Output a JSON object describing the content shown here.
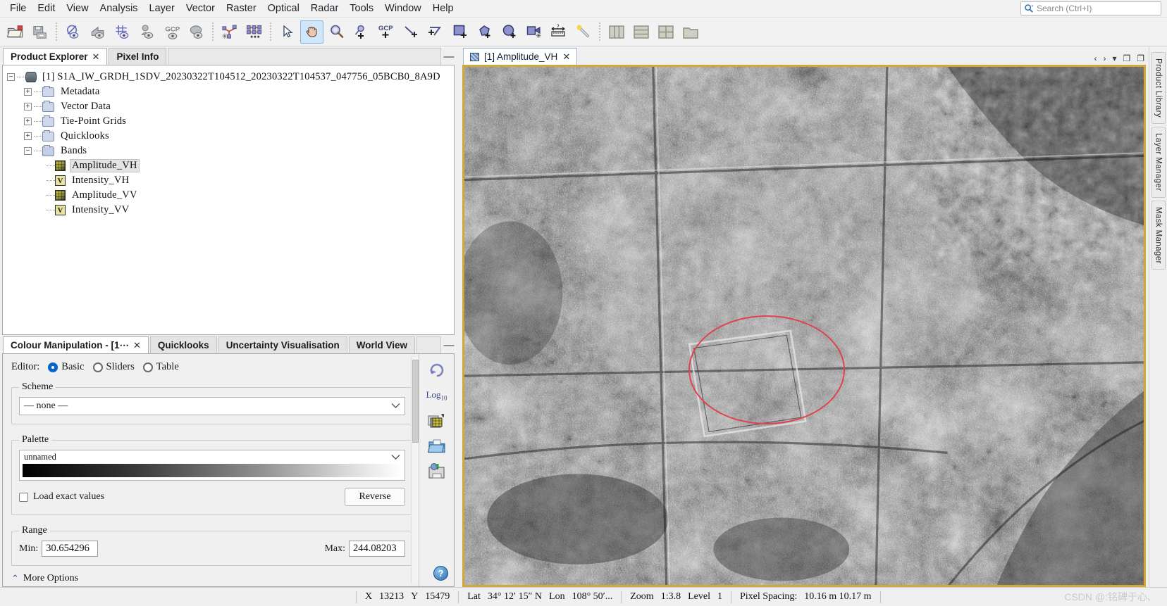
{
  "app": {
    "title": "SNAP Desktop"
  },
  "menubar": {
    "items": [
      {
        "label": "File"
      },
      {
        "label": "Edit"
      },
      {
        "label": "View"
      },
      {
        "label": "Analysis"
      },
      {
        "label": "Layer"
      },
      {
        "label": "Vector"
      },
      {
        "label": "Raster"
      },
      {
        "label": "Optical"
      },
      {
        "label": "Radar"
      },
      {
        "label": "Tools"
      },
      {
        "label": "Window"
      },
      {
        "label": "Help"
      }
    ],
    "search": {
      "icon": "search-icon",
      "placeholder": "Search  (Ctrl+I)"
    }
  },
  "toolbar": {
    "groups": [
      {
        "buttons": [
          {
            "name": "open-product-button",
            "icon": "open-folder-icon",
            "active": false
          },
          {
            "name": "save-product-button",
            "icon": "save-disk-icon",
            "active": false
          }
        ]
      },
      {
        "buttons": [
          {
            "name": "no-data-overlay-button",
            "icon": "no-data-overlay-icon",
            "active": false
          },
          {
            "name": "geo-coding-overlay-button",
            "icon": "geo-coding-overlay-icon",
            "active": false
          },
          {
            "name": "graticule-overlay-button",
            "icon": "graticule-overlay-icon",
            "active": false
          },
          {
            "name": "pin-overlay-button",
            "icon": "pin-overlay-icon",
            "active": false
          },
          {
            "name": "gcp-overlay-button",
            "icon": "gcp-overlay-icon",
            "active": false
          },
          {
            "name": "mask-overlay-button",
            "icon": "mask-overlay-icon",
            "active": false
          }
        ]
      },
      {
        "buttons": [
          {
            "name": "pin-manager-button",
            "icon": "pin-manager-icon",
            "active": false
          },
          {
            "name": "gcp-manager-button",
            "icon": "gcp-manager-icon",
            "active": false
          }
        ]
      },
      {
        "buttons": [
          {
            "name": "select-tool-button",
            "icon": "arrow-cursor-icon",
            "active": false
          },
          {
            "name": "pan-tool-button",
            "icon": "hand-pan-icon",
            "active": true
          },
          {
            "name": "zoom-tool-button",
            "icon": "magnifier-icon",
            "active": false
          },
          {
            "name": "pin-placing-tool-button",
            "icon": "pin-plus-icon",
            "active": false
          },
          {
            "name": "gcp-placing-tool-button",
            "icon": "gcp-plus-icon",
            "active": false
          },
          {
            "name": "line-drawing-tool-button",
            "icon": "line-plus-icon",
            "active": false
          },
          {
            "name": "polyline-drawing-tool-button",
            "icon": "polyline-plus-icon",
            "active": false
          },
          {
            "name": "rectangle-drawing-tool-button",
            "icon": "rectangle-plus-icon",
            "active": false
          },
          {
            "name": "polygon-drawing-tool-button",
            "icon": "polygon-plus-icon",
            "active": false
          },
          {
            "name": "ellipse-drawing-tool-button",
            "icon": "ellipse-plus-icon",
            "active": false
          },
          {
            "name": "magic-stick-button",
            "icon": "magic-stick-icon",
            "active": false
          },
          {
            "name": "range-finder-button",
            "icon": "measure-ruler-icon",
            "active": false
          },
          {
            "name": "colour-picker-button",
            "icon": "magic-wand-icon",
            "active": false
          }
        ]
      },
      {
        "buttons": [
          {
            "name": "tile-vertically-button",
            "icon": "tile-vertical-icon",
            "active": false
          },
          {
            "name": "tile-horizontally-button",
            "icon": "tile-horizontal-icon",
            "active": false
          },
          {
            "name": "tile-evenly-button",
            "icon": "tile-grid-icon",
            "active": false
          },
          {
            "name": "tile-single-button",
            "icon": "tile-single-icon",
            "active": false
          }
        ]
      }
    ]
  },
  "explorer": {
    "tabs": [
      {
        "label": "Product Explorer",
        "active": true,
        "closable": true
      },
      {
        "label": "Pixel Info",
        "active": false,
        "closable": false
      }
    ],
    "minimize_glyph": "—",
    "tree": {
      "root": {
        "label": "[1]  S1A_IW_GRDH_1SDV_20230322T104512_20230322T104537_047756_05BCB0_8A9D",
        "expander": "−",
        "icon": "product-icon"
      },
      "children": [
        {
          "label": "Metadata",
          "expander": "+",
          "icon": "folder-icon",
          "selected": false
        },
        {
          "label": "Vector Data",
          "expander": "+",
          "icon": "folder-icon",
          "selected": false
        },
        {
          "label": "Tie-Point Grids",
          "expander": "+",
          "icon": "folder-icon",
          "selected": false
        },
        {
          "label": "Quicklooks",
          "expander": "+",
          "icon": "folder-icon",
          "selected": false
        },
        {
          "label": "Bands",
          "expander": "−",
          "icon": "folder-open-icon",
          "selected": false
        }
      ],
      "bands": [
        {
          "label": "Amplitude_VH",
          "icon": "band-icon",
          "selected": true
        },
        {
          "label": "Intensity_VH",
          "icon": "virtual-band-icon",
          "selected": false
        },
        {
          "label": "Amplitude_VV",
          "icon": "band-icon",
          "selected": false
        },
        {
          "label": "Intensity_VV",
          "icon": "virtual-band-icon",
          "selected": false
        }
      ]
    }
  },
  "colour_manipulation": {
    "tabs": [
      {
        "label": "Colour Manipulation - [1⋯",
        "active": true,
        "closable": true
      },
      {
        "label": "Quicklooks",
        "active": false,
        "closable": false
      },
      {
        "label": "Uncertainty Visualisation",
        "active": false,
        "closable": false
      },
      {
        "label": "World View",
        "active": false,
        "closable": false
      }
    ],
    "minimize_glyph": "—",
    "editor": {
      "label": "Editor:",
      "options": [
        {
          "label": "Basic",
          "selected": true
        },
        {
          "label": "Sliders",
          "selected": false
        },
        {
          "label": "Table",
          "selected": false
        }
      ]
    },
    "scheme": {
      "legend": "Scheme",
      "value": "—  none  —",
      "chevron": "⌄"
    },
    "palette": {
      "legend": "Palette",
      "name": "unnamed",
      "chevron": "⌄",
      "gradient_from": "#000000",
      "gradient_to": "#ffffff",
      "load_exact_values": {
        "label": "Load exact values",
        "checked": false
      },
      "reverse_button": "Reverse"
    },
    "range": {
      "legend": "Range",
      "min_label": "Min:",
      "min_value": "30.654296",
      "max_label": "Max:",
      "max_value": "244.08203"
    },
    "more_options": {
      "label": "More Options",
      "caret": "⌃"
    },
    "side_buttons": [
      {
        "name": "reset-button",
        "icon": "reset-circular-arrow-icon"
      },
      {
        "name": "log10-button",
        "icon": "log10-text-icon",
        "label": "Log",
        "sub": "10"
      },
      {
        "name": "apply-to-other-bands-button",
        "icon": "multi-assign-icon"
      },
      {
        "name": "import-palette-button",
        "icon": "open-folder-icon"
      },
      {
        "name": "export-palette-button",
        "icon": "save-disk-icon"
      }
    ],
    "help_button": "?"
  },
  "image_view": {
    "tab": {
      "label": "[1]  Amplitude_VH",
      "icon": "image-band-icon",
      "closable": true
    },
    "controls": [
      {
        "name": "scroll-left-button",
        "glyph": "‹"
      },
      {
        "name": "scroll-right-button",
        "glyph": "›"
      },
      {
        "name": "show-list-button",
        "glyph": "▾"
      },
      {
        "name": "maximize-button",
        "glyph": "❐"
      },
      {
        "name": "float-button",
        "glyph": "❐"
      }
    ],
    "annotation": {
      "name": "ellipse-annotation",
      "colour": "#e0434f"
    },
    "border_colour": "#d1a83a"
  },
  "right_dock": {
    "tabs": [
      {
        "label": "Product Library",
        "icon": "library-icon"
      },
      {
        "label": "Layer Manager",
        "icon": "layers-icon"
      },
      {
        "label": "Mask Manager",
        "icon": "mask-icon"
      }
    ]
  },
  "statusbar": {
    "x_label": "X",
    "x_value": "13213",
    "y_label": "Y",
    "y_value": "15479",
    "lat_label": "Lat",
    "lat_value": "34° 12′ 15″ N",
    "lon_label": "Lon",
    "lon_value": "108° 50′...",
    "zoom_label": "Zoom",
    "zoom_value": "1:3.8",
    "level_label": "Level",
    "level_value": "1",
    "pixel_spacing_label": "Pixel Spacing:",
    "pixel_spacing_value": "10.16 m 10.17 m",
    "watermark": "CSDN @:铭碑于心、"
  }
}
